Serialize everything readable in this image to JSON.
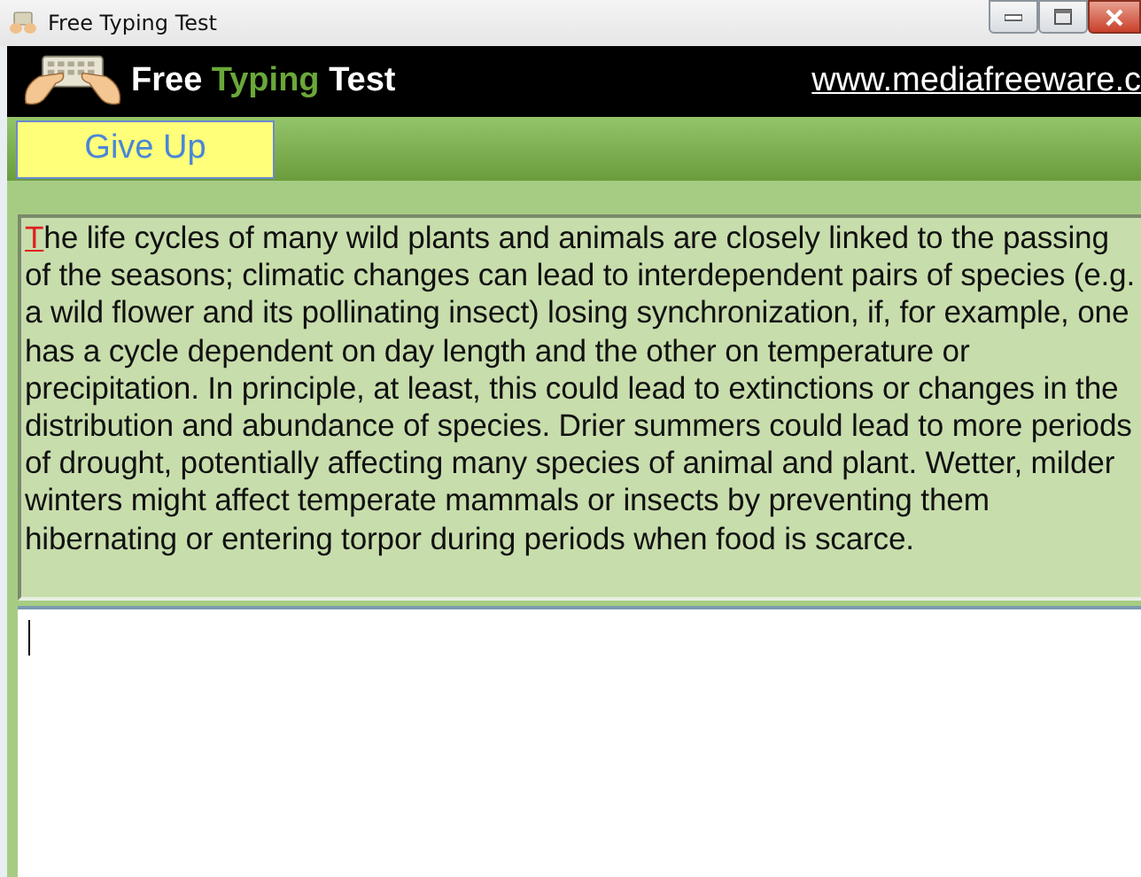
{
  "window": {
    "title": "Free Typing Test"
  },
  "header": {
    "title_parts": [
      {
        "text": "Free",
        "kind": "plain"
      },
      {
        "text": "Typing",
        "kind": "accent"
      },
      {
        "text": "Test",
        "kind": "plain"
      }
    ],
    "link": "www.mediafreeware.c"
  },
  "toolbar": {
    "buttons": [
      "Give Up"
    ]
  },
  "passage": {
    "current": "T",
    "rest": "he life cycles of many wild plants and animals are closely linked to the passing of the seasons; climatic changes can lead to interdependent pairs of species (e.g. a wild flower and its pollinating insect) losing synchronization, if, for example, one has a cycle dependent on day length and the other on temperature or precipitation. In principle, at least, this could lead to extinctions or changes in the distribution and abundance of species. Drier summers could lead to more periods of drought, potentially affecting many species of animal and plant. Wetter, milder winters might affect temperate mammals or insects by preventing them hibernating or entering torpor during periods when food is scarce."
  }
}
